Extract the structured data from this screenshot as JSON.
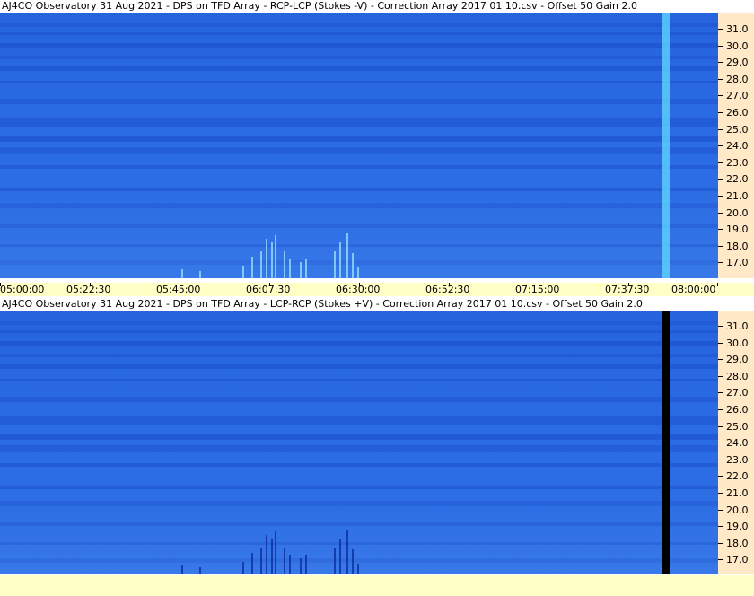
{
  "panels": [
    {
      "title": "AJ4CO Observatory 31 Aug 2021  -  DPS on TFD Array  -  RCP-LCP (Stokes -V)  -  Correction Array 2017 01 10.csv  -  Offset 50  Gain 2.0",
      "variant": "bright",
      "event_column_color": "#5fd3ff"
    },
    {
      "title": "AJ4CO Observatory 31 Aug 2021  -  DPS on TFD Array  -  LCP-RCP (Stokes +V)  -  Correction Array 2017 01 10.csv  -  Offset 50  Gain 2.0",
      "variant": "inverted",
      "event_column_color": "#000000"
    }
  ],
  "freq_axis": {
    "labels": [
      "31.0",
      "30.0",
      "29.0",
      "28.0",
      "27.0",
      "26.0",
      "25.0",
      "24.0",
      "23.0",
      "22.0",
      "21.0",
      "20.0",
      "19.0",
      "18.0",
      "17.0"
    ]
  },
  "time_axis": {
    "labels": [
      "05:00:00",
      "05:22:30",
      "05:45:00",
      "06:07:30",
      "06:30:00",
      "06:52:30",
      "07:15:00",
      "07:37:30",
      "08:00:00"
    ]
  },
  "colors": {
    "background_blue": "#2d6fe6",
    "band_blue": "#1f55d0",
    "freq_panel": "#ffe9c6",
    "time_axis": "#ffffc6"
  }
}
